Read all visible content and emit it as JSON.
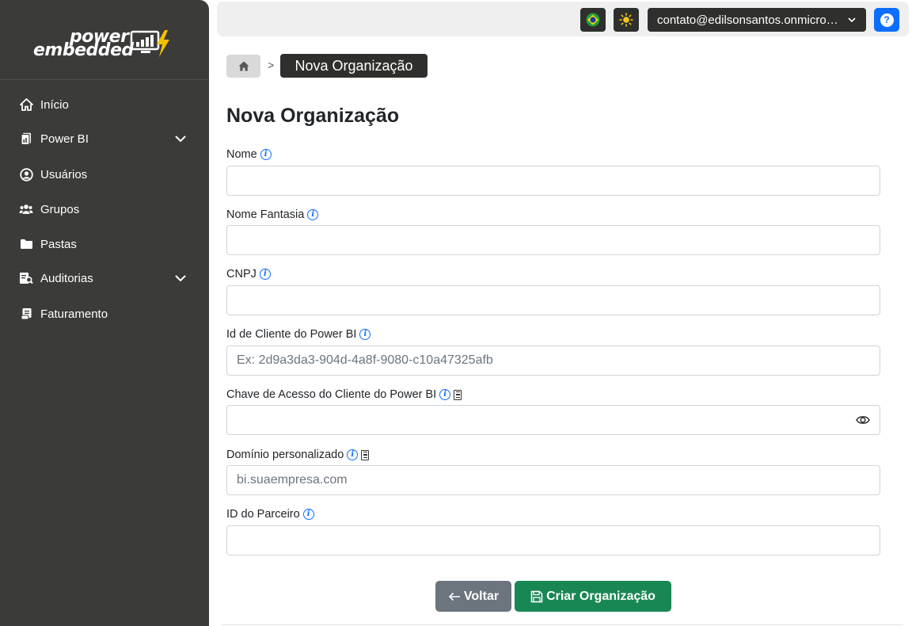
{
  "brand": {
    "line1": "power",
    "line2": "embedded"
  },
  "sidebar": {
    "items": [
      {
        "label": "Início",
        "icon": "home-icon"
      },
      {
        "label": "Power BI",
        "icon": "report-icon",
        "expandable": true
      },
      {
        "label": "Usuários",
        "icon": "user-circle-icon"
      },
      {
        "label": "Grupos",
        "icon": "users-icon"
      },
      {
        "label": "Pastas",
        "icon": "folder-icon"
      },
      {
        "label": "Auditorias",
        "icon": "audit-icon",
        "expandable": true
      },
      {
        "label": "Faturamento",
        "icon": "receipt-icon"
      }
    ]
  },
  "topbar": {
    "language_icon": "brazil-flag-icon",
    "theme_icon": "sun-icon",
    "user_email": "contato@edilsonsantos.onmicro…",
    "help_label": "?"
  },
  "breadcrumb": {
    "separator": ">",
    "current": "Nova Organização"
  },
  "page": {
    "title": "Nova Organização"
  },
  "form": {
    "fields": [
      {
        "label": "Nome",
        "value": "",
        "placeholder": ""
      },
      {
        "label": "Nome Fantasia",
        "value": "",
        "placeholder": ""
      },
      {
        "label": "CNPJ",
        "value": "",
        "placeholder": ""
      },
      {
        "label": "Id de Cliente do Power BI",
        "value": "",
        "placeholder": "Ex: 2d9a3da3-904d-4a8f-9080-c10a47325afb"
      },
      {
        "label": "Chave de Acesso do Cliente do Power BI",
        "value": "",
        "placeholder": ""
      },
      {
        "label": "Domínio personalizado",
        "value": "",
        "placeholder": "bi.suaempresa.com"
      },
      {
        "label": "ID do Parceiro",
        "value": "",
        "placeholder": ""
      }
    ]
  },
  "actions": {
    "back_label": "Voltar",
    "create_label": "Criar Organização"
  },
  "colors": {
    "sidebar": "#3b3b39",
    "primary": "#0d6efd",
    "success": "#198754",
    "secondary": "#6c757d"
  }
}
